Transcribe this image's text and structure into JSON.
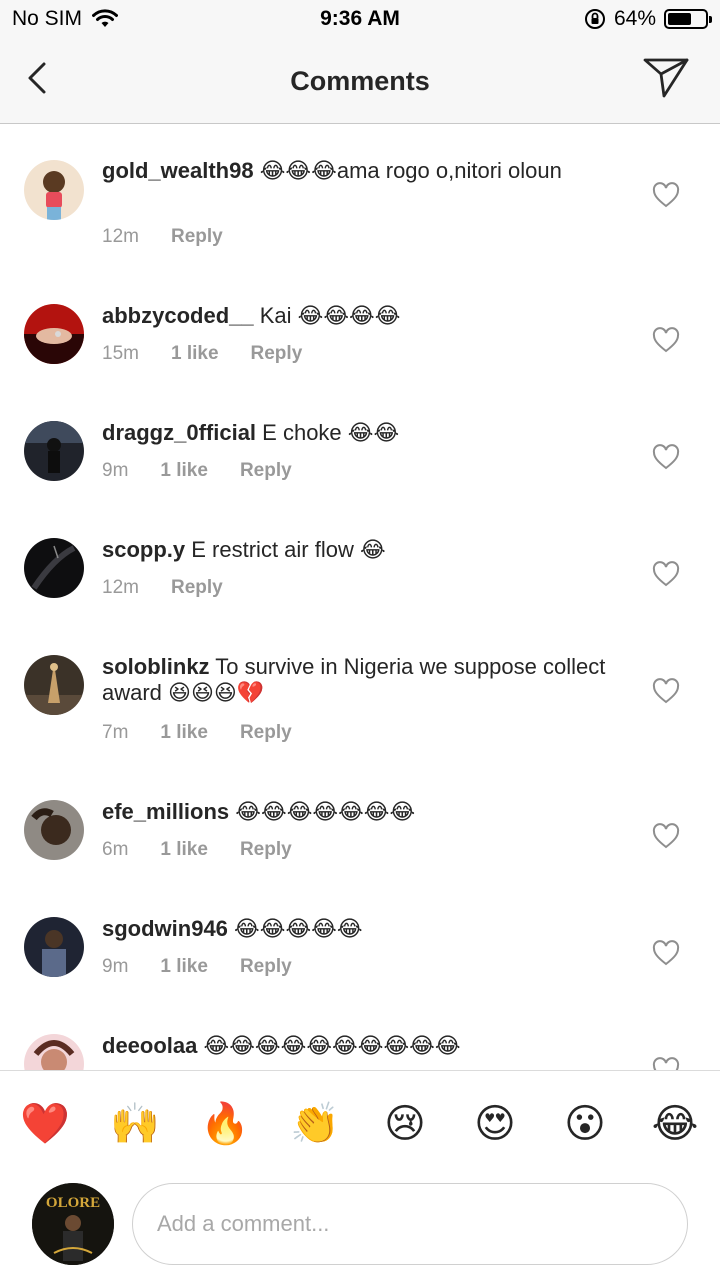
{
  "status_bar": {
    "carrier": "No SIM",
    "time": "9:36 AM",
    "battery_percent": "64%",
    "battery_level": 0.64
  },
  "nav": {
    "title": "Comments",
    "back_icon": "chevron-left-icon",
    "share_icon": "paper-plane-icon"
  },
  "comments": [
    {
      "username": "gold_wealth98",
      "text": "😂😂😂ama rogo o,nitori oloun",
      "time": "12m",
      "likes": "",
      "reply": "Reply"
    },
    {
      "username": "abbzycoded__",
      "text": "Kai 😂😂😂😂",
      "time": "15m",
      "likes": "1 like",
      "reply": "Reply"
    },
    {
      "username": "draggz_0fficial",
      "text": "E choke 😂😂",
      "time": "9m",
      "likes": "1 like",
      "reply": "Reply"
    },
    {
      "username": "scopp.y",
      "text": "E restrict air flow 😂",
      "time": "12m",
      "likes": "",
      "reply": "Reply"
    },
    {
      "username": "soloblinkz",
      "text": "To survive in Nigeria we suppose collect award 😆😆😆💔",
      "time": "7m",
      "likes": "1 like",
      "reply": "Reply"
    },
    {
      "username": "efe_millions",
      "text": "😂😂😂😂😂😂😂",
      "time": "6m",
      "likes": "1 like",
      "reply": "Reply"
    },
    {
      "username": "sgodwin946",
      "text": "😂😂😂😂😂",
      "time": "9m",
      "likes": "1 like",
      "reply": "Reply"
    },
    {
      "username": "deeoolaa",
      "text": "😂😂😂😂😂😂😂😂😂😂",
      "time": "",
      "likes": "",
      "reply": ""
    }
  ],
  "reactions": [
    "❤️",
    "🙌",
    "🔥",
    "👏",
    "😢",
    "😍",
    "😮",
    "😂"
  ],
  "composer": {
    "placeholder": "Add a comment...",
    "avatar_text": "OLORE"
  },
  "colors": {
    "text": "#262626",
    "secondary": "#999999",
    "bar_bg": "#f7f7f7",
    "divider": "#dbdbdb"
  }
}
